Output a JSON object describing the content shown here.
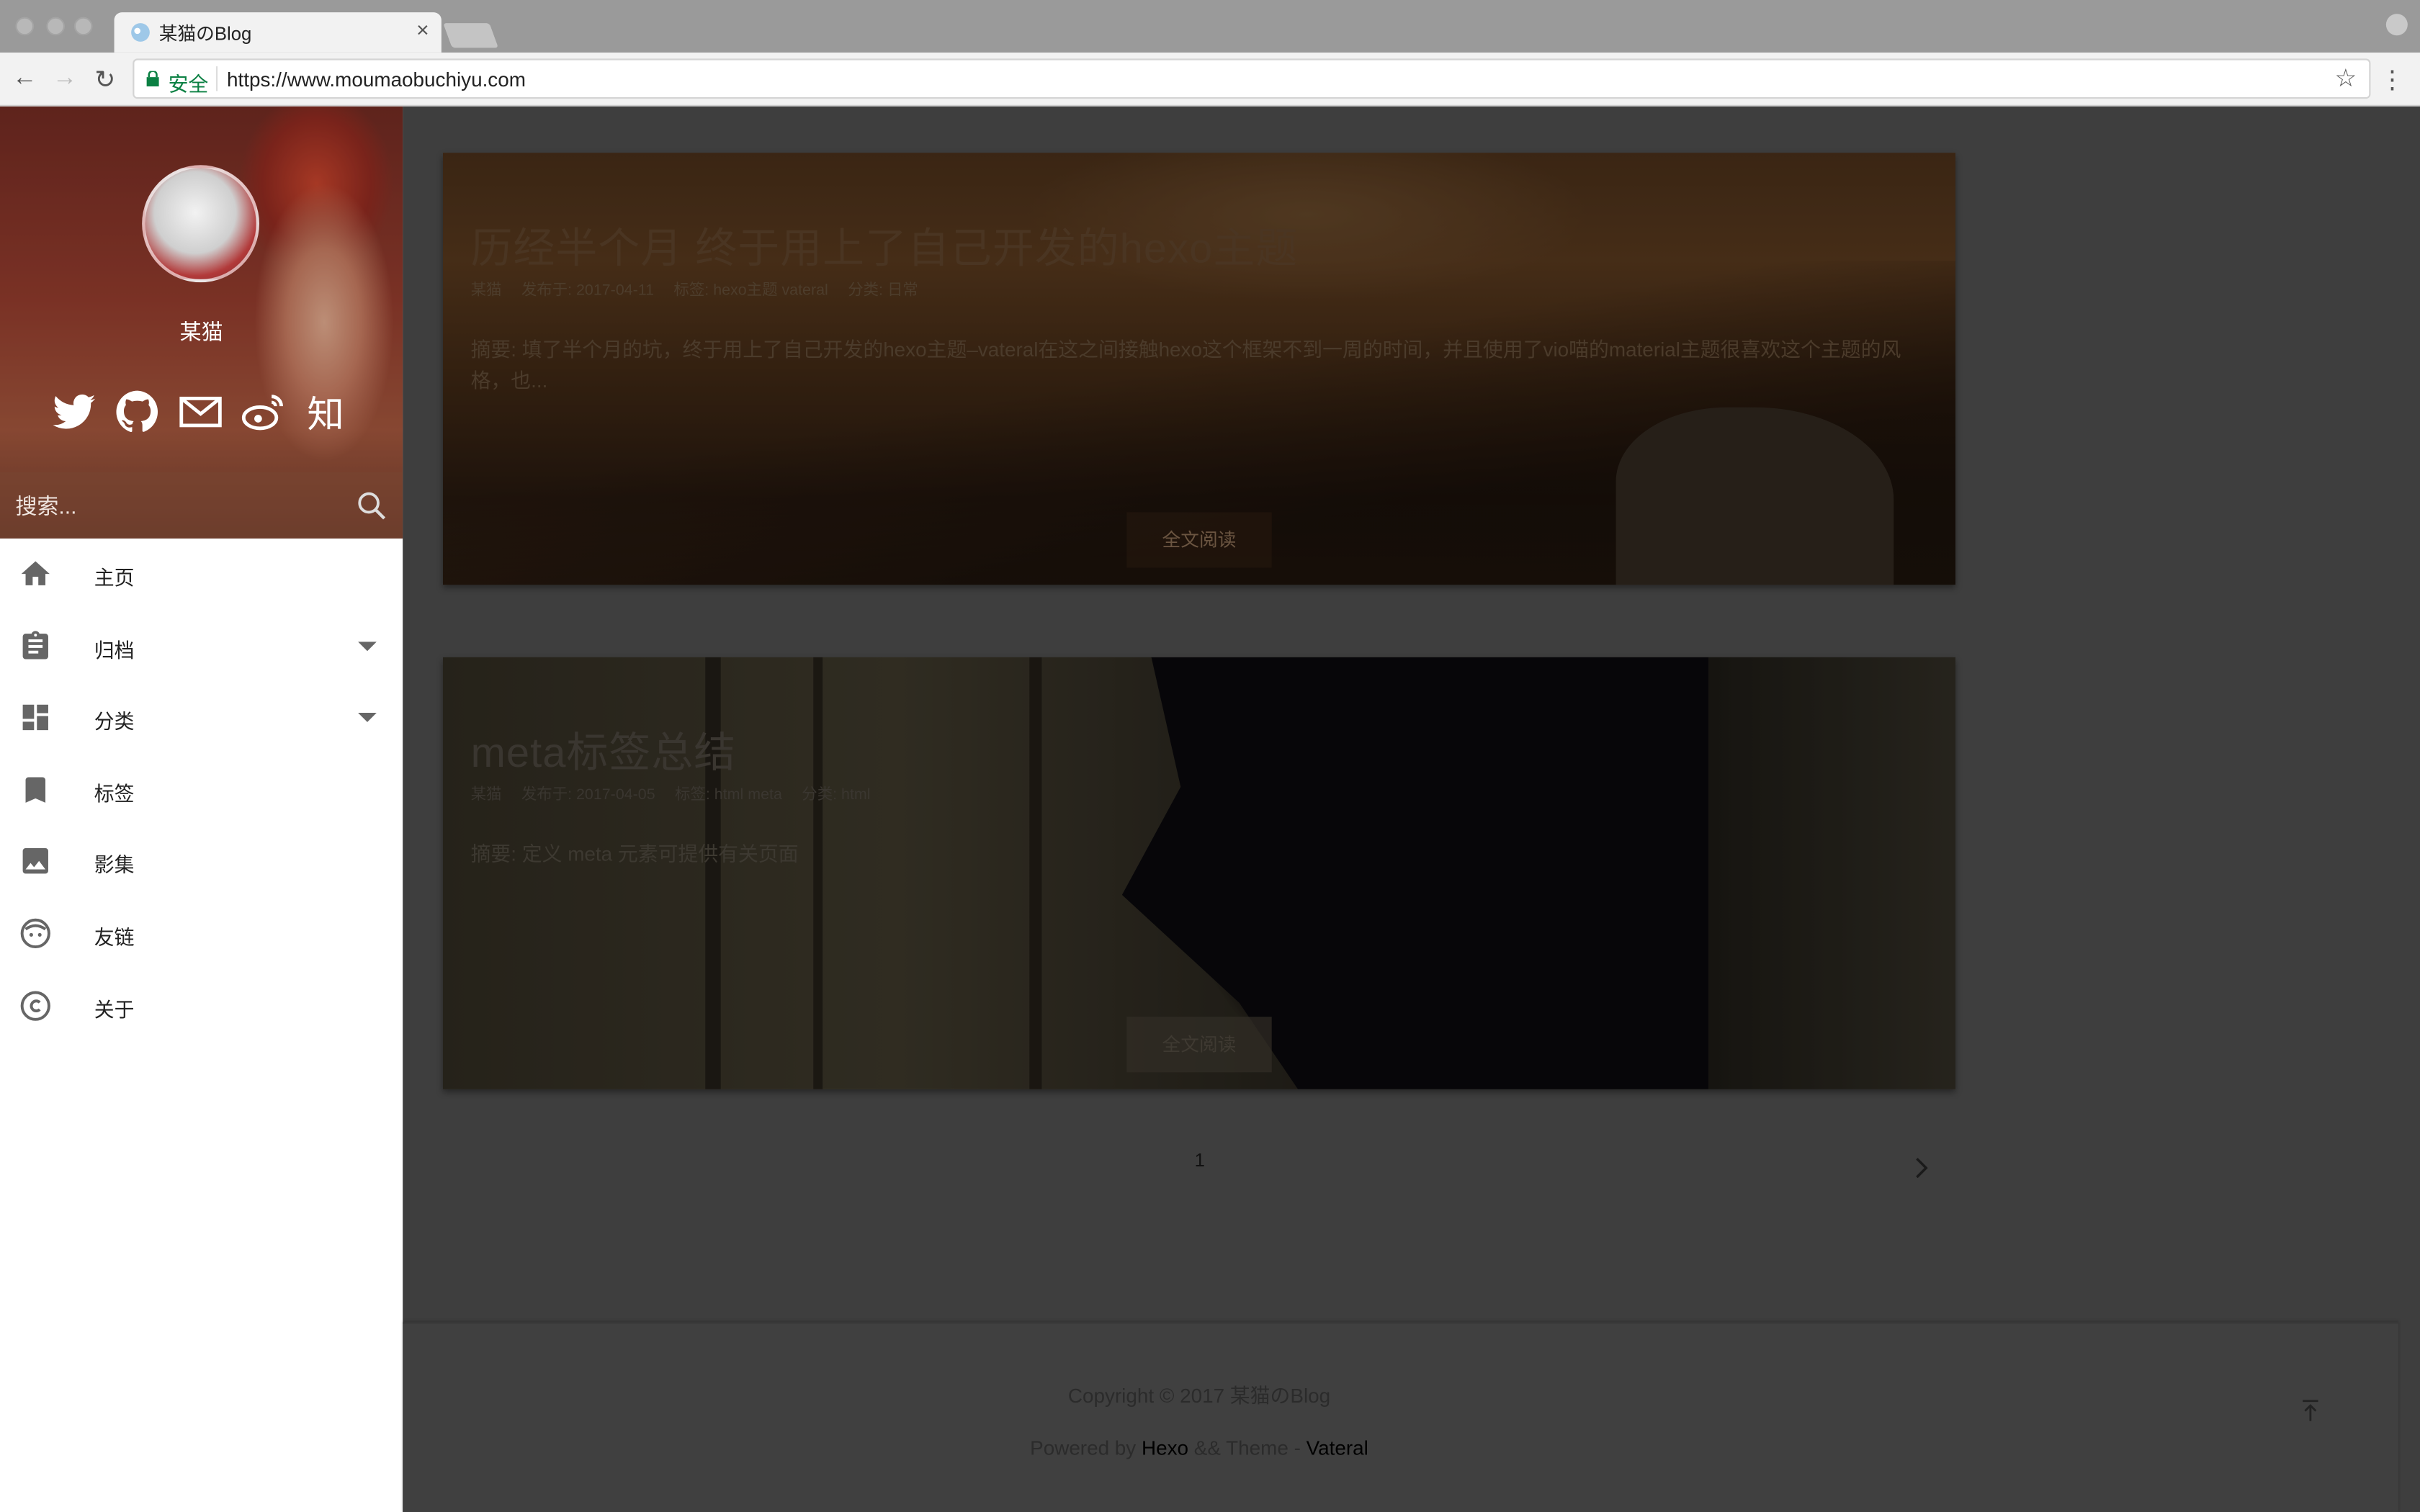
{
  "browser": {
    "tab_title": "某猫のBlog",
    "tab_close": "×",
    "secure_label": "安全",
    "url": "https://www.moumaobuchiyu.com",
    "back": "←",
    "forward": "→",
    "reload": "↻",
    "star": "☆",
    "menu": "⋮"
  },
  "sidebar": {
    "author": "某猫",
    "social_zhihu": "知",
    "search_placeholder": "搜索...",
    "menu": [
      {
        "label": "主页",
        "icon": "home-icon"
      },
      {
        "label": "归档",
        "icon": "clipboard-icon",
        "expandable": true
      },
      {
        "label": "分类",
        "icon": "dashboard-icon",
        "expandable": true
      },
      {
        "label": "标签",
        "icon": "bookmark-icon"
      },
      {
        "label": "影集",
        "icon": "image-icon"
      },
      {
        "label": "友链",
        "icon": "face-icon"
      },
      {
        "label": "关于",
        "icon": "copyright-icon"
      }
    ]
  },
  "posts": [
    {
      "title": "历经半个月 终于用上了自己开发的hexo主题",
      "author": "某猫",
      "date": "发布于: 2017-04-11",
      "tags": "标签: hexo主题 vateral",
      "category": "分类: 日常",
      "excerpt": "摘要: 填了半个月的坑，终于用上了自己开发的hexo主题–vateral在这之间接触hexo这个框架不到一周的时间，并且使用了vio喵的material主题很喜欢这个主题的风格，也...",
      "read_more": "全文阅读"
    },
    {
      "title": "meta标签总结",
      "author": "某猫",
      "date": "发布于: 2017-04-05",
      "tags": "标签: html meta",
      "category": "分类: html",
      "excerpt": "摘要: 定义 meta 元素可提供有关页面",
      "read_more": "全文阅读"
    }
  ],
  "pagination": {
    "current": "1"
  },
  "footer": {
    "copyright": "Copyright © 2017 某猫のBlog",
    "powered_prefix": "Powered by ",
    "hexo": "Hexo",
    "theme_mid": " && Theme - ",
    "vateral": "Vateral"
  }
}
